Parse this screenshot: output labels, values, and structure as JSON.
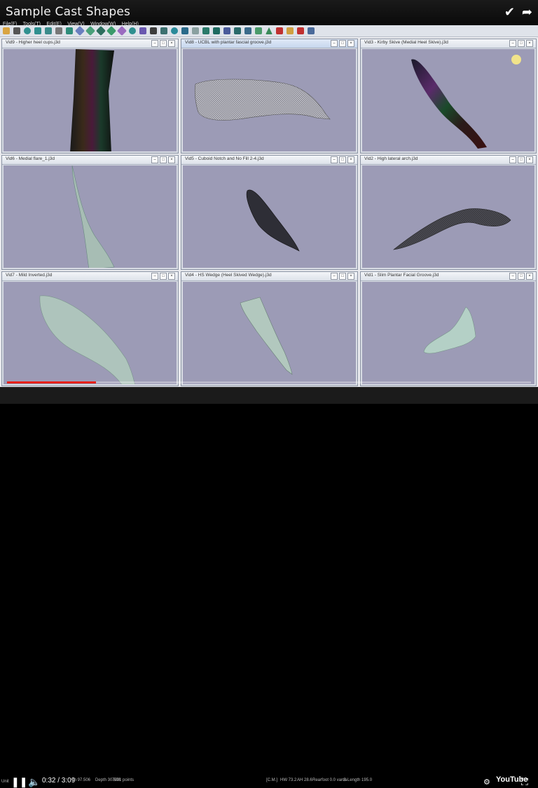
{
  "window": {
    "title": "Sample Cast Shapes"
  },
  "menu": [
    "File(F)",
    "Tools(T)",
    "Edit(E)",
    "View(V)",
    "Window(W)",
    "Help(H)"
  ],
  "top_icons": [
    "checkmark-icon",
    "share-icon"
  ],
  "panes": [
    {
      "title": "Vid9 - Higher heel cups.j3d"
    },
    {
      "title": "Vid8 - UCBL with plantar fascial groove.j3d"
    },
    {
      "title": "Vid3 - Kirby Skive (Medial Heel Skive).j3d"
    },
    {
      "title": "Vid6 - Medial flare_1.j3d"
    },
    {
      "title": "Vid5 - Cuboid Notch and No Fill 2-4.j3d"
    },
    {
      "title": "Vid2 - High lateral arch.j3d"
    },
    {
      "title": "Vid7 - Mild Inverted.j3d"
    },
    {
      "title": "Vid4 - HS Wedge (Heel Skived Wedge).j3d"
    },
    {
      "title": "Vid1 - Slim Plantar Facial Groove.j3d"
    }
  ],
  "status": {
    "left": "Unit",
    "width": "th 97.506",
    "depth": "Depth 30.508",
    "points": "7001 points",
    "cm": "[C.M.]",
    "hw": "HW 73.2",
    "ah": "AH 28.6",
    "rearfoot": "Rearfoot 0.0 varus",
    "slength": "S-Length 195.0"
  },
  "video": {
    "time": "0:32 / 3:09",
    "progress": 0.17,
    "logo": "YouTube"
  },
  "colors": {
    "viewport": "#9c9bb6",
    "titlebar": "#111111",
    "progress": "#e62117"
  }
}
